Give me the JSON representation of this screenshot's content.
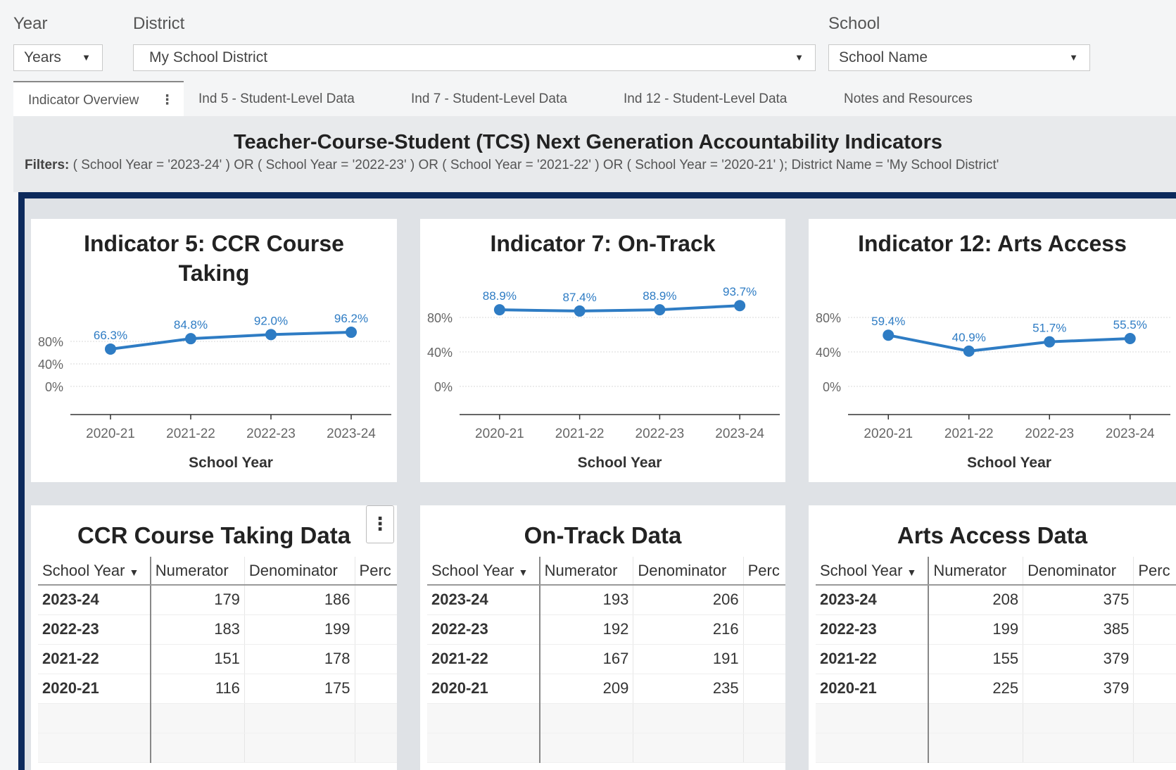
{
  "filters": {
    "year_label": "Year",
    "year_value": "Years",
    "district_label": "District",
    "district_value": "My School District",
    "school_label": "School",
    "school_value": "School Name"
  },
  "tabs": [
    {
      "label": "Indicator Overview",
      "active": true
    },
    {
      "label": "Ind 5 - Student-Level Data"
    },
    {
      "label": "Ind 7 - Student-Level Data"
    },
    {
      "label": "Ind 12 - Student-Level Data"
    },
    {
      "label": "Notes and Resources"
    }
  ],
  "report": {
    "title": "Teacher-Course-Student (TCS) Next Generation Accountability Indicators",
    "filters_label": "Filters:",
    "filters_text": "( School Year = '2023-24' ) OR ( School Year = '2022-23' ) OR ( School Year = '2021-22' ) OR ( School Year = '2020-21' ); District Name =  'My School District'"
  },
  "colors": {
    "line": "#2e7cc4",
    "frame": "#0d2a5c"
  },
  "chart_data": [
    {
      "type": "line",
      "title_lines": [
        "Indicator 5: CCR Course",
        "Taking"
      ],
      "xlabel": "School Year",
      "categories": [
        "2020-21",
        "2021-22",
        "2022-23",
        "2023-24"
      ],
      "values": [
        66.3,
        84.8,
        92.0,
        96.2
      ],
      "data_labels": [
        "66.3%",
        "84.8%",
        "92.0%",
        "96.2%"
      ],
      "y_ticks": [
        "80%",
        "40%",
        "0%"
      ],
      "grid": true
    },
    {
      "type": "line",
      "title_lines": [
        "Indicator 7: On-Track"
      ],
      "xlabel": "School Year",
      "categories": [
        "2020-21",
        "2021-22",
        "2022-23",
        "2023-24"
      ],
      "values": [
        88.9,
        87.4,
        88.9,
        93.7
      ],
      "data_labels": [
        "88.9%",
        "87.4%",
        "88.9%",
        "93.7%"
      ],
      "y_ticks": [
        "80%",
        "40%",
        "0%"
      ],
      "grid": true
    },
    {
      "type": "line",
      "title_lines": [
        "Indicator 12: Arts Access"
      ],
      "xlabel": "School Year",
      "categories": [
        "2020-21",
        "2021-22",
        "2022-23",
        "2023-24"
      ],
      "values": [
        59.4,
        40.9,
        51.7,
        55.5
      ],
      "data_labels": [
        "59.4%",
        "40.9%",
        "51.7%",
        "55.5%"
      ],
      "y_ticks": [
        "80%",
        "40%",
        "0%"
      ],
      "grid": true
    }
  ],
  "tables": [
    {
      "title": "CCR Course Taking Data",
      "columns": [
        "School Year",
        "Numerator",
        "Denominator",
        "Perc"
      ],
      "rows": [
        {
          "year": "2023-24",
          "num": "179",
          "den": "186"
        },
        {
          "year": "2022-23",
          "num": "183",
          "den": "199"
        },
        {
          "year": "2021-22",
          "num": "151",
          "den": "178"
        },
        {
          "year": "2020-21",
          "num": "116",
          "den": "175"
        }
      ]
    },
    {
      "title": "On-Track Data",
      "columns": [
        "School Year",
        "Numerator",
        "Denominator",
        "Perc"
      ],
      "rows": [
        {
          "year": "2023-24",
          "num": "193",
          "den": "206"
        },
        {
          "year": "2022-23",
          "num": "192",
          "den": "216"
        },
        {
          "year": "2021-22",
          "num": "167",
          "den": "191"
        },
        {
          "year": "2020-21",
          "num": "209",
          "den": "235"
        }
      ]
    },
    {
      "title": "Arts Access Data",
      "columns": [
        "School Year",
        "Numerator",
        "Denominator",
        "Perc"
      ],
      "rows": [
        {
          "year": "2023-24",
          "num": "208",
          "den": "375"
        },
        {
          "year": "2022-23",
          "num": "199",
          "den": "385"
        },
        {
          "year": "2021-22",
          "num": "155",
          "den": "379"
        },
        {
          "year": "2020-21",
          "num": "225",
          "den": "379"
        }
      ]
    }
  ],
  "icons": {
    "kebab": "more-vertical-icon",
    "caret": "caret-down-icon"
  }
}
